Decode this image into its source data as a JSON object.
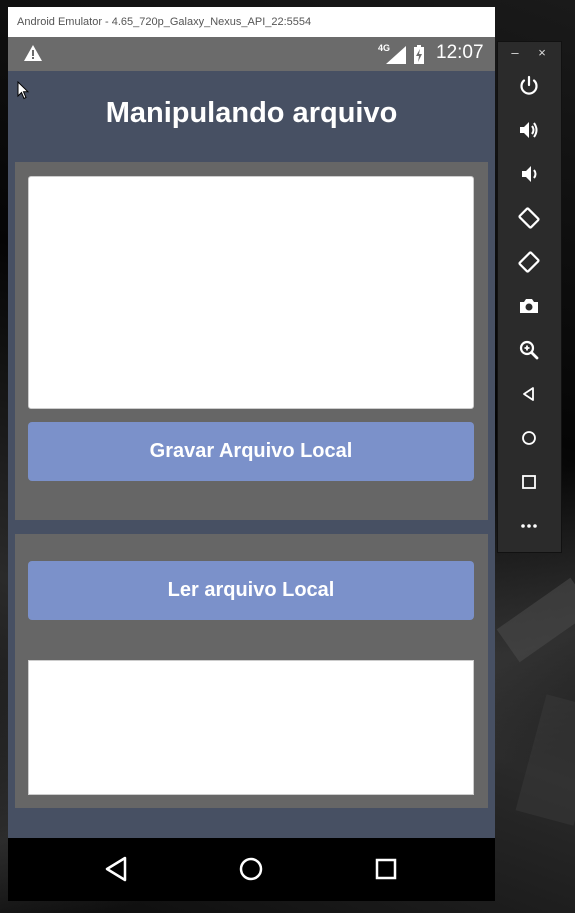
{
  "window": {
    "title": "Android Emulator - 4.65_720p_Galaxy_Nexus_API_22:5554"
  },
  "status_bar": {
    "network": "4G",
    "time": "12:07",
    "icons": [
      "warning-icon",
      "signal-icon",
      "battery-charging-icon"
    ]
  },
  "app": {
    "title": "Manipulando arquivo",
    "write_input_value": "",
    "write_button_label": "Gravar Arquivo Local",
    "read_button_label": "Ler arquivo Local",
    "read_output_value": ""
  },
  "nav_bar": {
    "icons": [
      "back-icon",
      "home-icon",
      "recents-icon"
    ]
  },
  "toolbar": {
    "minimize": "–",
    "close": "×",
    "items": [
      "power",
      "volume-up",
      "volume-down",
      "rotate-left",
      "rotate-right",
      "screenshot",
      "zoom",
      "back",
      "home",
      "overview",
      "more"
    ]
  },
  "colors": {
    "app_background": "#475063",
    "panel": "#666666",
    "button": "#7b91ca",
    "status_bar": "#6b6b6b"
  }
}
